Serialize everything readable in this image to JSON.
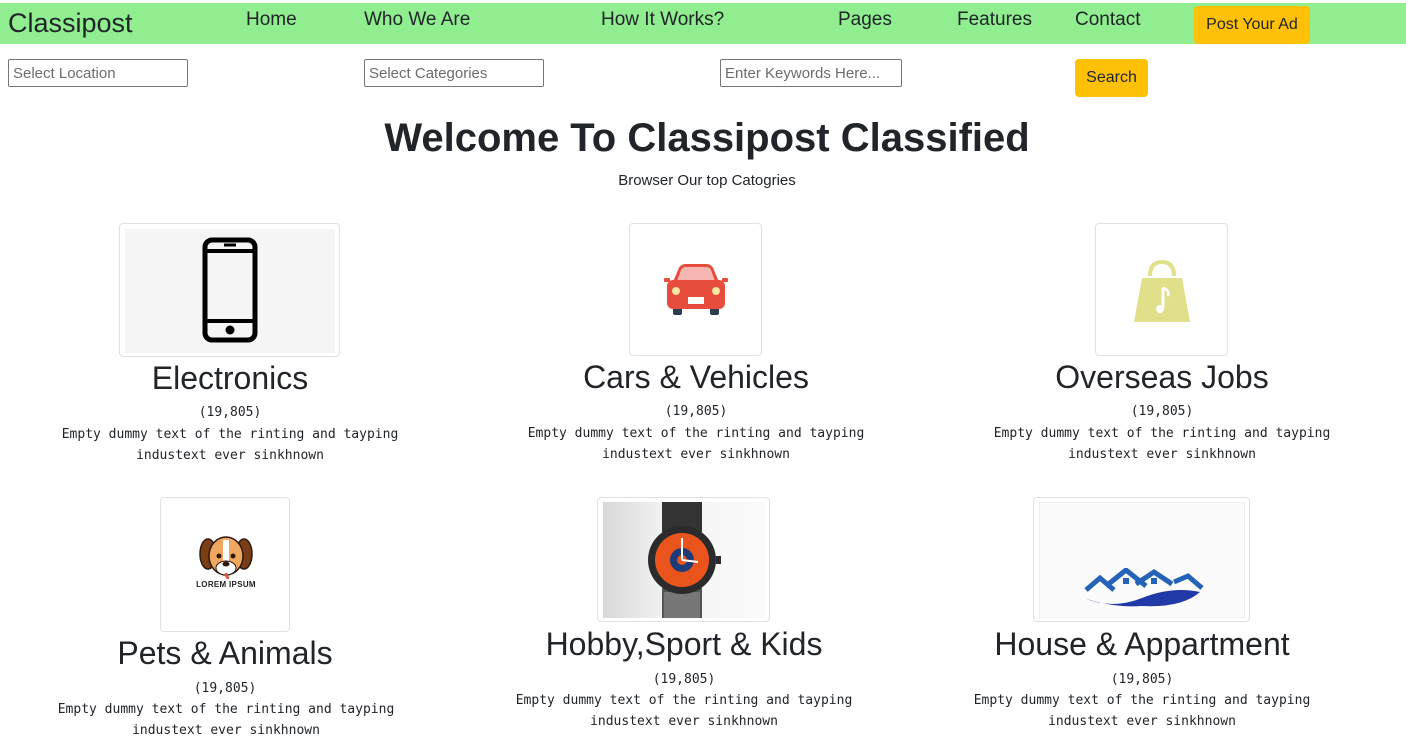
{
  "brand": "Classipost",
  "nav": {
    "links": [
      "Home",
      "Who We Are",
      "How It Works?",
      "Pages",
      "Features",
      "Contact"
    ],
    "post_button": "Post Your Ad"
  },
  "search": {
    "location_placeholder": "Select Location",
    "categories_placeholder": "Select Categories",
    "keywords_placeholder": "Enter Keywords Here...",
    "button": "Search"
  },
  "hero": {
    "title": "Welcome To Classipost Classified",
    "subtitle": "Browser Our top Catogries"
  },
  "categories": [
    {
      "title": "Electronics",
      "count": "(19,805)",
      "desc": "Empty dummy text of the rinting and tayping industext ever sinkhnown",
      "icon": "smartphone-icon"
    },
    {
      "title": "Cars & Vehicles",
      "count": "(19,805)",
      "desc": "Empty dummy text of the rinting and tayping industext ever sinkhnown",
      "icon": "car-icon"
    },
    {
      "title": "Overseas Jobs",
      "count": "(19,805)",
      "desc": "Empty dummy text of the rinting and tayping industext ever sinkhnown",
      "icon": "shopping-bag-icon"
    },
    {
      "title": "Pets & Animals",
      "count": "(19,805)",
      "desc": "Empty dummy text of the rinting and tayping industext ever sinkhnown",
      "icon": "dog-icon",
      "logo_text": "LOREM IPSUM"
    },
    {
      "title": "Hobby,Sport & Kids",
      "count": "(19,805)",
      "desc": "Empty dummy text of the rinting and tayping industext ever sinkhnown",
      "icon": "watch-icon"
    },
    {
      "title": "House & Appartment",
      "count": "(19,805)",
      "desc": "Empty dummy text of the rinting and tayping industext ever sinkhnown",
      "icon": "houses-icon"
    }
  ],
  "colors": {
    "navbar": "#90ee90",
    "accent": "#ffc107",
    "text": "#212529"
  }
}
